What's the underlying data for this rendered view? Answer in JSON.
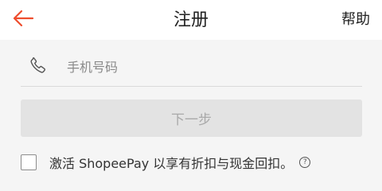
{
  "header": {
    "title": "注册",
    "help_label": "帮助",
    "back_icon": "arrow-left-icon"
  },
  "colors": {
    "accent": "#ee4d2d",
    "button_disabled_bg": "#e3e3e3",
    "button_disabled_text": "#a9a9a9"
  },
  "form": {
    "phone_icon": "phone-icon",
    "phone_placeholder": "手机号码",
    "next_label": "下一步"
  },
  "consent": {
    "checked": false,
    "text": "激活 ShopeePay 以享有折扣与现金回扣。",
    "help_glyph": "?"
  }
}
